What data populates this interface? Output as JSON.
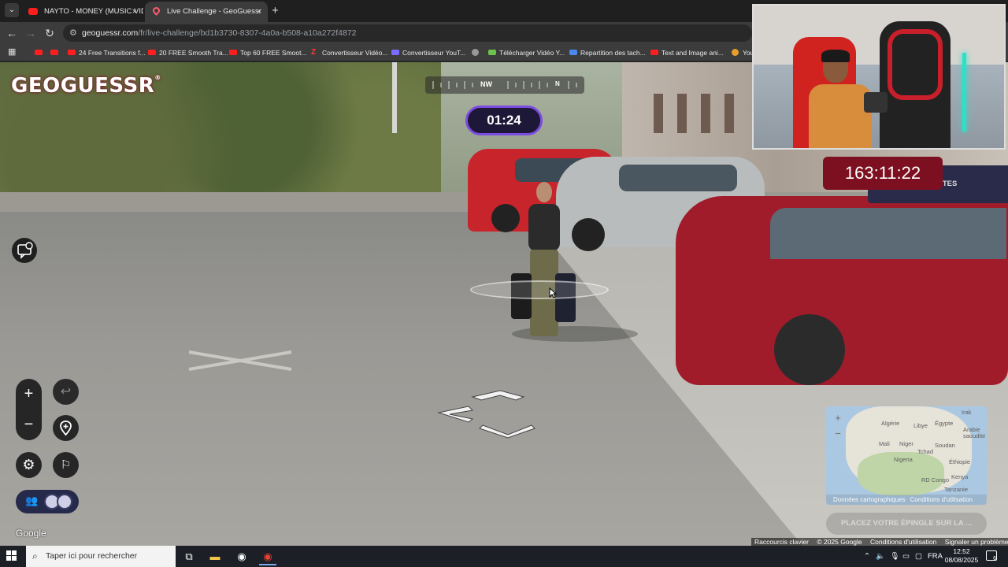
{
  "browser": {
    "tabs": [
      {
        "title": "NAYTO - MONEY (MUSIC VIDEO",
        "active": false
      },
      {
        "title": "Live Challenge - GeoGuessr",
        "active": true
      }
    ],
    "close_glyph": "×",
    "new_tab_glyph": "+",
    "url_host": "geoguessr.com",
    "url_path": "/fr/live-challenge/bd1b3730-8307-4a0a-b508-a10a272f4872",
    "bookmarks": [
      {
        "label": "",
        "icon": "youtube-icon"
      },
      {
        "label": "",
        "icon": "youtube-icon"
      },
      {
        "label": "24 Free Transitions f...",
        "icon": "youtube-icon"
      },
      {
        "label": "20 FREE Smooth Tra...",
        "icon": "youtube-icon"
      },
      {
        "label": "Top 60 FREE Smoot...",
        "icon": "youtube-icon"
      },
      {
        "label": "Convertisseur Vidéo...",
        "icon": "z-icon"
      },
      {
        "label": "Convertisseur YouT...",
        "icon": "link-icon"
      },
      {
        "label": "",
        "icon": "globe-icon"
      },
      {
        "label": "Télécharger Vidéo Y...",
        "icon": "download-icon"
      },
      {
        "label": "Repartition des tach...",
        "icon": "doc-icon"
      },
      {
        "label": "Text and Image ani...",
        "icon": "youtube-icon"
      },
      {
        "label": "You",
        "icon": "orange-icon"
      }
    ]
  },
  "game": {
    "logo": "GEOGUESSR",
    "logo_mark": "®",
    "compass": {
      "primary": "NW",
      "secondary": "N"
    },
    "round_timer": "01:24",
    "zoom_in": "+",
    "zoom_out": "−",
    "undo_glyph": "↩",
    "settings_glyph": "⚙",
    "flag_glyph": "⚐",
    "players_glyph": "👥",
    "google_watermark": "Google",
    "minimap": {
      "labels": [
        "Irak",
        "Algérie",
        "Libye",
        "Égypte",
        "Arabie saoudite",
        "Mali",
        "Niger",
        "Tchad",
        "Soudan",
        "Nigeria",
        "Éthiopie",
        "RD Congo",
        "Kenya",
        "Tanzanie"
      ],
      "zoom_in": "+",
      "zoom_out": "−",
      "map_data": "Données cartographiques",
      "terms": "Conditions d'utilisation"
    },
    "place_pin_button": "PLACEZ VOTRE ÉPINGLE SUR LA ...",
    "footer": [
      "Raccourcis clavier",
      "© 2025 Google",
      "Conditions d'utilisation",
      "Signaler un problème"
    ]
  },
  "stream": {
    "big_timer": "163:11:22",
    "side_panel_text": "NTES"
  },
  "taskbar": {
    "search_placeholder": "Taper ici pour rechercher",
    "language": "FRA",
    "time": "12:52",
    "date": "08/08/2025",
    "notification_count": "6"
  },
  "colors": {
    "timer_border": "#7c4be0",
    "timer_bg": "#1e1838",
    "big_timer_bg": "#7d1020",
    "logo_red": "#e32b3f"
  }
}
